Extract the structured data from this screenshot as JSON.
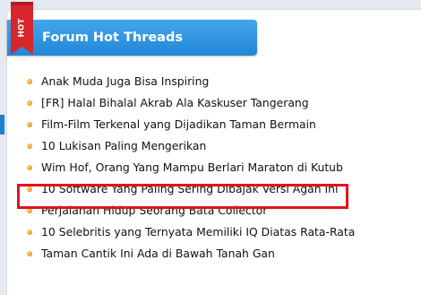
{
  "panel": {
    "title": "Forum Hot Threads",
    "badge": "HOT"
  },
  "threads": [
    {
      "title": "Anak Muda Juga Bisa Inspiring"
    },
    {
      "title": "[FR] Halal Bihalal Akrab Ala Kaskuser Tangerang"
    },
    {
      "title": "Film-Film Terkenal yang Dijadikan Taman Bermain"
    },
    {
      "title": "10 Lukisan Paling Mengerikan"
    },
    {
      "title": "Wim Hof, Orang Yang Mampu Berlari Maraton di Kutub"
    },
    {
      "title": "10 Software Yang Paling Sering Dibajak Versi Agan Ini",
      "highlighted": true
    },
    {
      "title": "Perjalanan Hidup Seorang Bata Collector"
    },
    {
      "title": "10 Selebritis yang Ternyata Memiliki IQ Diatas Rata-Rata"
    },
    {
      "title": "Taman Cantik Ini Ada di Bawah Tanah Gan"
    }
  ],
  "colors": {
    "header_top": "#43a6ec",
    "header_bottom": "#2286d6",
    "ribbon": "#d8262d",
    "bullet": "#f4a21c",
    "highlight_border": "#e0141f"
  },
  "icons": {
    "badge": "hot-ribbon-icon",
    "bullet": "bullet-dot-icon"
  }
}
